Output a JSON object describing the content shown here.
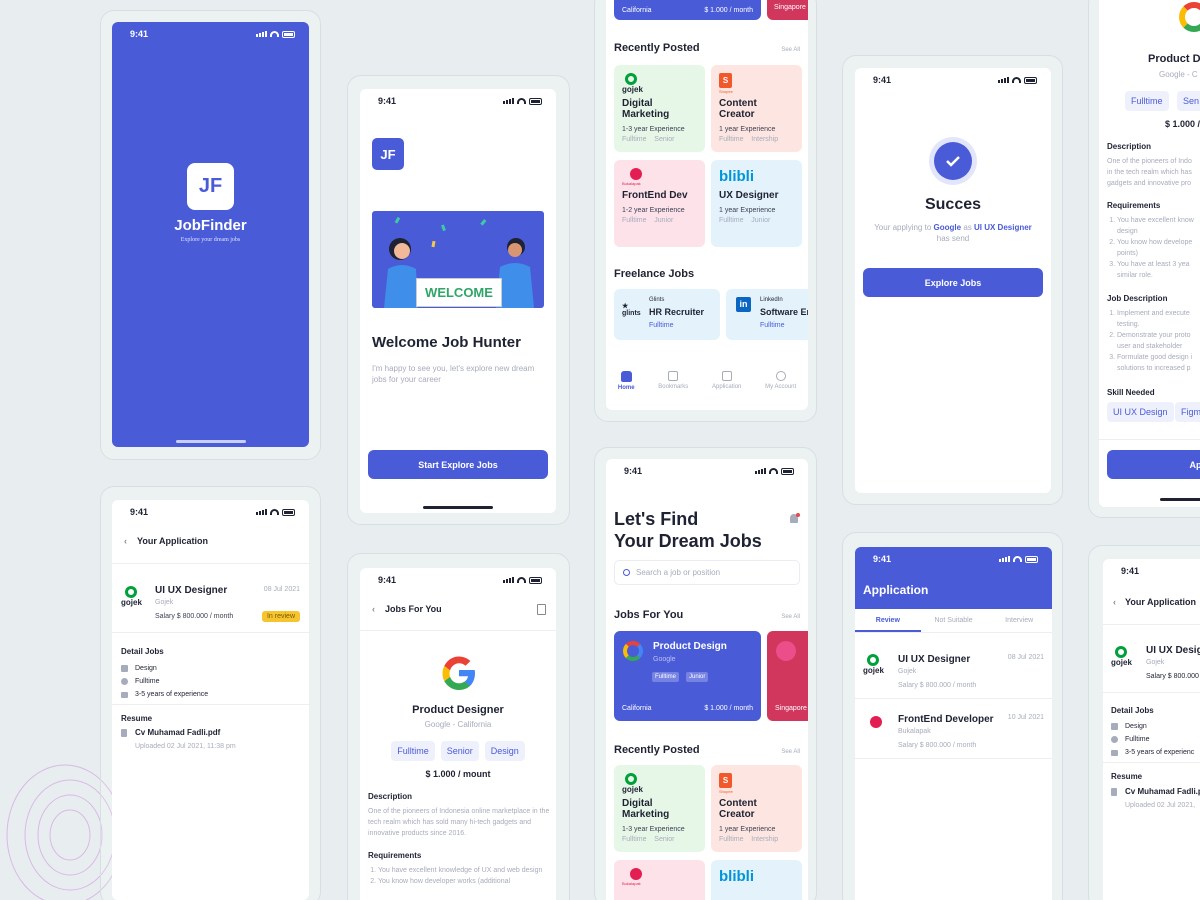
{
  "time": "9:41",
  "splash": {
    "logo": "JF",
    "name": "JobFinder",
    "tagline": "Explore your dream jobs"
  },
  "welcome": {
    "logo": "JF",
    "banner": "WELCOME",
    "title": "Welcome Job Hunter",
    "subtitle": "I'm happy to see you, let's explore new dream jobs for your career",
    "button": "Start Explore Jobs"
  },
  "your_application": {
    "title": "Your Application",
    "job": "UI UX Designer",
    "company": "Gojek",
    "date": "08 Jul 2021",
    "salary": "Salary $ 800.000 / month",
    "status": "In review",
    "detail_title": "Detail Jobs",
    "details": [
      "Design",
      "Fulltime",
      "3-5 years of experience"
    ],
    "resume_title": "Resume",
    "resume_file": "Cv Muhamad Fadli.pdf",
    "resume_date": "Uploaded 02 Jul 2021, 11:38 pm"
  },
  "jobs_for_you": {
    "title": "Jobs For You",
    "job": "Product Designer",
    "company": "Google - California",
    "tags": [
      "Fulltime",
      "Senior",
      "Design"
    ],
    "salary": "$ 1.000 / mount",
    "desc_title": "Description",
    "desc": "One of the pioneers of Indonesia online marketplace in the tech realm which has sold many hi-tech gadgets and innovative products since 2016.",
    "req_title": "Requirements",
    "reqs": [
      "You have excellent knowledge of UX and web design",
      "You know how developer works (additional"
    ]
  },
  "home": {
    "top_location": "California",
    "top_salary": "$ 1.000 / month",
    "top_location2": "Singapore",
    "recent_title": "Recently Posted",
    "see_all": "See All",
    "recent": [
      {
        "title": "Digital Marketing",
        "exp": "1-3 year Experience",
        "meta": "Fulltime    Senior",
        "logo": "gojek"
      },
      {
        "title": "Content Creator",
        "exp": "1 year Experience",
        "meta": "Fulltime    Intership",
        "logo": "Shopee"
      },
      {
        "title": "FrontEnd Dev",
        "exp": "1-2 year Experience",
        "meta": "Fulltime    Junior",
        "logo": "Bukalapak"
      },
      {
        "title": "UX Designer",
        "exp": "1 year Experience",
        "meta": "Fulltime    Junior",
        "logo": "blibli"
      }
    ],
    "freelance_title": "Freelance Jobs",
    "freelance": [
      {
        "company": "Glints",
        "title": "HR Recruiter",
        "type": "Fulltime"
      },
      {
        "company": "LinkedIn",
        "title": "Software En",
        "type": "Fulltime"
      }
    ],
    "tabs": [
      "Home",
      "Bookmarks",
      "Application",
      "My Account"
    ]
  },
  "find": {
    "title1": "Let's Find",
    "title2": "Your Dream Jobs",
    "search_placeholder": "Search a job or position",
    "jobs_title": "Jobs For You",
    "see_all": "See All",
    "featured": {
      "title": "Product Design",
      "company": "Google",
      "tags": [
        "Fulltime",
        "Junior"
      ],
      "location": "California",
      "salary": "$ 1.000 / month"
    },
    "featured2_location": "Singapore",
    "recent_title": "Recently Posted",
    "recent": [
      {
        "title": "Digital Marketing",
        "exp": "1-3 year Experience",
        "meta": "Fulltime    Senior"
      },
      {
        "title": "Content Creator",
        "exp": "1 year Experience",
        "meta": "Fulltime    Intership"
      }
    ]
  },
  "success": {
    "title": "Succes",
    "text1": "Your applying to",
    "company": "Google",
    "text2": "as",
    "role": "UI UX Designer",
    "text3": "has send",
    "button": "Explore Jobs"
  },
  "application": {
    "title": "Application",
    "tabs": [
      "Review",
      "Not Suitable",
      "Interview"
    ],
    "items": [
      {
        "job": "UI UX Designer",
        "company": "Gojek",
        "date": "08 Jul 2021",
        "salary": "Salary $ 800.000 / month"
      },
      {
        "job": "FrontEnd Developer",
        "company": "Bukalapak",
        "date": "10 Jul 2021",
        "salary": "Salary $ 800.000 / month"
      }
    ]
  },
  "product_detail": {
    "title": "Product D",
    "company": "Google - C",
    "tags": [
      "Fulltime",
      "Sen"
    ],
    "salary": "$ 1.000 /",
    "desc_title": "Description",
    "desc": "One of the pioneers of Indo in the tech realm which has gadgets and innovative pro",
    "req_title": "Requirements",
    "reqs": [
      "You have excellent know design",
      "You know how develope points)",
      "You have at least 3 yea similar role."
    ],
    "jd_title": "Job Description",
    "jd": [
      "Implement and execute testing.",
      "Demonstrate your proto user and stakeholder",
      "Formulate good design i solutions to increased p"
    ],
    "skill_title": "Skill  Needed",
    "skills": [
      "UI UX Design",
      "Figm"
    ],
    "button": "App"
  },
  "your_application2": {
    "title": "Your Application",
    "job": "UI UX Design",
    "company": "Gojek",
    "salary": "Salary $ 800.000",
    "detail_title": "Detail Jobs",
    "details": [
      "Design",
      "Fulltime",
      "3-5 years of experienc"
    ],
    "resume_title": "Resume",
    "resume_file": "Cv Muhamad Fadli.pdf",
    "resume_date": "Uploaded 02 Jul 2021,"
  }
}
